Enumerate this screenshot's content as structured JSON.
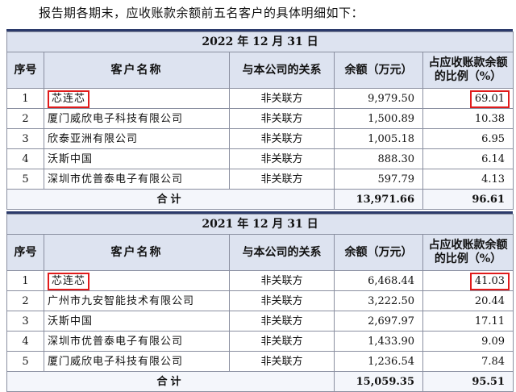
{
  "intro": "报告期各期末，应收账款余额前五名客户的具体明细如下：",
  "headers": {
    "idx": "序号",
    "name": "客户名称",
    "relation": "与本公司的关系",
    "balance": "余额（万元）",
    "ratio": "占应收账款余额的比例（%）"
  },
  "tables": [
    {
      "period": "2022 年 12 月 31 日",
      "rows": [
        {
          "idx": "1",
          "name": "芯连芯",
          "relation": "非关联方",
          "balance": "9,979.50",
          "ratio": "69.01",
          "highlight": true
        },
        {
          "idx": "2",
          "name": "厦门威欣电子科技有限公司",
          "relation": "非关联方",
          "balance": "1,500.89",
          "ratio": "10.38"
        },
        {
          "idx": "3",
          "name": "欣泰亚洲有限公司",
          "relation": "非关联方",
          "balance": "1,005.18",
          "ratio": "6.95"
        },
        {
          "idx": "4",
          "name": "沃斯中国",
          "relation": "非关联方",
          "balance": "888.30",
          "ratio": "6.14"
        },
        {
          "idx": "5",
          "name": "深圳市优普泰电子有限公司",
          "relation": "非关联方",
          "balance": "597.79",
          "ratio": "4.13"
        }
      ],
      "total": {
        "label": "合计",
        "balance": "13,971.66",
        "ratio": "96.61"
      }
    },
    {
      "period": "2021 年 12 月 31 日",
      "rows": [
        {
          "idx": "1",
          "name": "芯连芯",
          "relation": "非关联方",
          "balance": "6,468.44",
          "ratio": "41.03",
          "highlight": true
        },
        {
          "idx": "2",
          "name": "广州市九安智能技术有限公司",
          "relation": "非关联方",
          "balance": "3,222.50",
          "ratio": "20.44"
        },
        {
          "idx": "3",
          "name": "沃斯中国",
          "relation": "非关联方",
          "balance": "2,697.97",
          "ratio": "17.11"
        },
        {
          "idx": "4",
          "name": "深圳市优普泰电子有限公司",
          "relation": "非关联方",
          "balance": "1,433.90",
          "ratio": "9.09"
        },
        {
          "idx": "5",
          "name": "厦门威欣电子科技有限公司",
          "relation": "非关联方",
          "balance": "1,236.54",
          "ratio": "7.84"
        }
      ],
      "total": {
        "label": "合计",
        "balance": "15,059.35",
        "ratio": "95.51"
      }
    }
  ],
  "colors": {
    "header_bg": "#dde3f0",
    "highlight_border": "#e01b1b",
    "rule": "#2b3a6b"
  }
}
